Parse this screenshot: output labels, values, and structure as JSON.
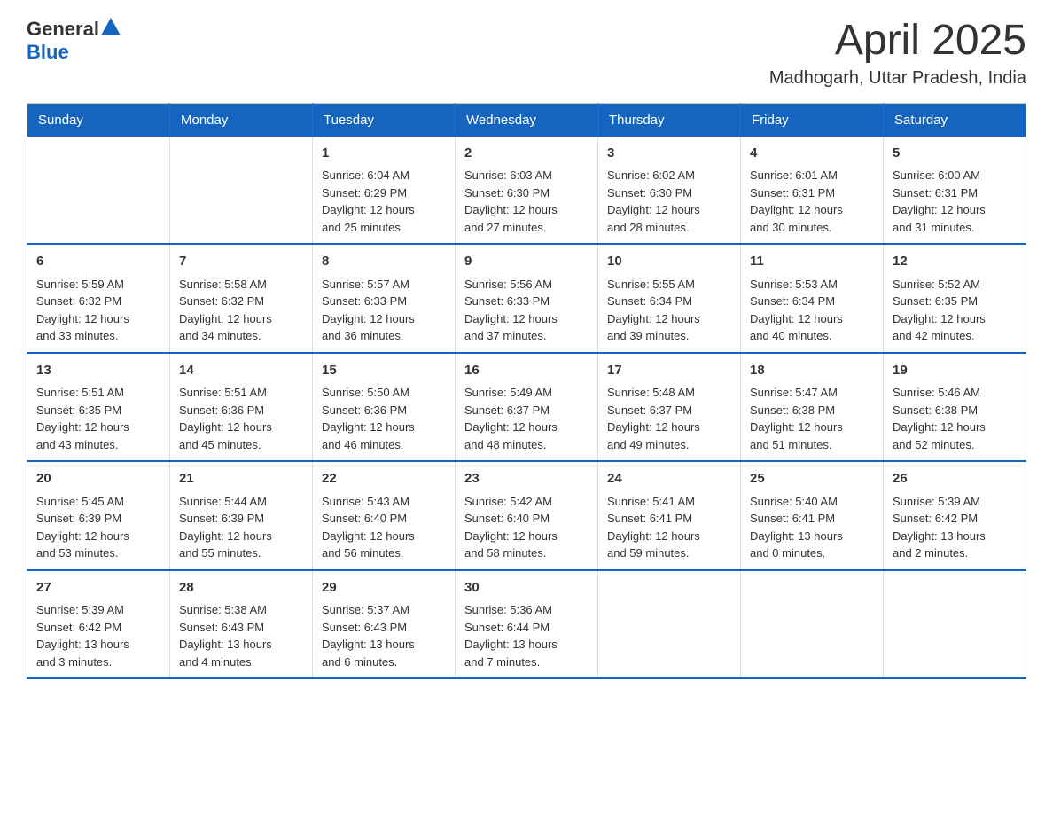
{
  "header": {
    "logo": {
      "general": "General",
      "blue": "Blue"
    },
    "month": "April 2025",
    "location": "Madhogarh, Uttar Pradesh, India"
  },
  "days_of_week": [
    "Sunday",
    "Monday",
    "Tuesday",
    "Wednesday",
    "Thursday",
    "Friday",
    "Saturday"
  ],
  "weeks": [
    [
      {
        "day": "",
        "info": ""
      },
      {
        "day": "",
        "info": ""
      },
      {
        "day": "1",
        "info": "Sunrise: 6:04 AM\nSunset: 6:29 PM\nDaylight: 12 hours\nand 25 minutes."
      },
      {
        "day": "2",
        "info": "Sunrise: 6:03 AM\nSunset: 6:30 PM\nDaylight: 12 hours\nand 27 minutes."
      },
      {
        "day": "3",
        "info": "Sunrise: 6:02 AM\nSunset: 6:30 PM\nDaylight: 12 hours\nand 28 minutes."
      },
      {
        "day": "4",
        "info": "Sunrise: 6:01 AM\nSunset: 6:31 PM\nDaylight: 12 hours\nand 30 minutes."
      },
      {
        "day": "5",
        "info": "Sunrise: 6:00 AM\nSunset: 6:31 PM\nDaylight: 12 hours\nand 31 minutes."
      }
    ],
    [
      {
        "day": "6",
        "info": "Sunrise: 5:59 AM\nSunset: 6:32 PM\nDaylight: 12 hours\nand 33 minutes."
      },
      {
        "day": "7",
        "info": "Sunrise: 5:58 AM\nSunset: 6:32 PM\nDaylight: 12 hours\nand 34 minutes."
      },
      {
        "day": "8",
        "info": "Sunrise: 5:57 AM\nSunset: 6:33 PM\nDaylight: 12 hours\nand 36 minutes."
      },
      {
        "day": "9",
        "info": "Sunrise: 5:56 AM\nSunset: 6:33 PM\nDaylight: 12 hours\nand 37 minutes."
      },
      {
        "day": "10",
        "info": "Sunrise: 5:55 AM\nSunset: 6:34 PM\nDaylight: 12 hours\nand 39 minutes."
      },
      {
        "day": "11",
        "info": "Sunrise: 5:53 AM\nSunset: 6:34 PM\nDaylight: 12 hours\nand 40 minutes."
      },
      {
        "day": "12",
        "info": "Sunrise: 5:52 AM\nSunset: 6:35 PM\nDaylight: 12 hours\nand 42 minutes."
      }
    ],
    [
      {
        "day": "13",
        "info": "Sunrise: 5:51 AM\nSunset: 6:35 PM\nDaylight: 12 hours\nand 43 minutes."
      },
      {
        "day": "14",
        "info": "Sunrise: 5:51 AM\nSunset: 6:36 PM\nDaylight: 12 hours\nand 45 minutes."
      },
      {
        "day": "15",
        "info": "Sunrise: 5:50 AM\nSunset: 6:36 PM\nDaylight: 12 hours\nand 46 minutes."
      },
      {
        "day": "16",
        "info": "Sunrise: 5:49 AM\nSunset: 6:37 PM\nDaylight: 12 hours\nand 48 minutes."
      },
      {
        "day": "17",
        "info": "Sunrise: 5:48 AM\nSunset: 6:37 PM\nDaylight: 12 hours\nand 49 minutes."
      },
      {
        "day": "18",
        "info": "Sunrise: 5:47 AM\nSunset: 6:38 PM\nDaylight: 12 hours\nand 51 minutes."
      },
      {
        "day": "19",
        "info": "Sunrise: 5:46 AM\nSunset: 6:38 PM\nDaylight: 12 hours\nand 52 minutes."
      }
    ],
    [
      {
        "day": "20",
        "info": "Sunrise: 5:45 AM\nSunset: 6:39 PM\nDaylight: 12 hours\nand 53 minutes."
      },
      {
        "day": "21",
        "info": "Sunrise: 5:44 AM\nSunset: 6:39 PM\nDaylight: 12 hours\nand 55 minutes."
      },
      {
        "day": "22",
        "info": "Sunrise: 5:43 AM\nSunset: 6:40 PM\nDaylight: 12 hours\nand 56 minutes."
      },
      {
        "day": "23",
        "info": "Sunrise: 5:42 AM\nSunset: 6:40 PM\nDaylight: 12 hours\nand 58 minutes."
      },
      {
        "day": "24",
        "info": "Sunrise: 5:41 AM\nSunset: 6:41 PM\nDaylight: 12 hours\nand 59 minutes."
      },
      {
        "day": "25",
        "info": "Sunrise: 5:40 AM\nSunset: 6:41 PM\nDaylight: 13 hours\nand 0 minutes."
      },
      {
        "day": "26",
        "info": "Sunrise: 5:39 AM\nSunset: 6:42 PM\nDaylight: 13 hours\nand 2 minutes."
      }
    ],
    [
      {
        "day": "27",
        "info": "Sunrise: 5:39 AM\nSunset: 6:42 PM\nDaylight: 13 hours\nand 3 minutes."
      },
      {
        "day": "28",
        "info": "Sunrise: 5:38 AM\nSunset: 6:43 PM\nDaylight: 13 hours\nand 4 minutes."
      },
      {
        "day": "29",
        "info": "Sunrise: 5:37 AM\nSunset: 6:43 PM\nDaylight: 13 hours\nand 6 minutes."
      },
      {
        "day": "30",
        "info": "Sunrise: 5:36 AM\nSunset: 6:44 PM\nDaylight: 13 hours\nand 7 minutes."
      },
      {
        "day": "",
        "info": ""
      },
      {
        "day": "",
        "info": ""
      },
      {
        "day": "",
        "info": ""
      }
    ]
  ]
}
